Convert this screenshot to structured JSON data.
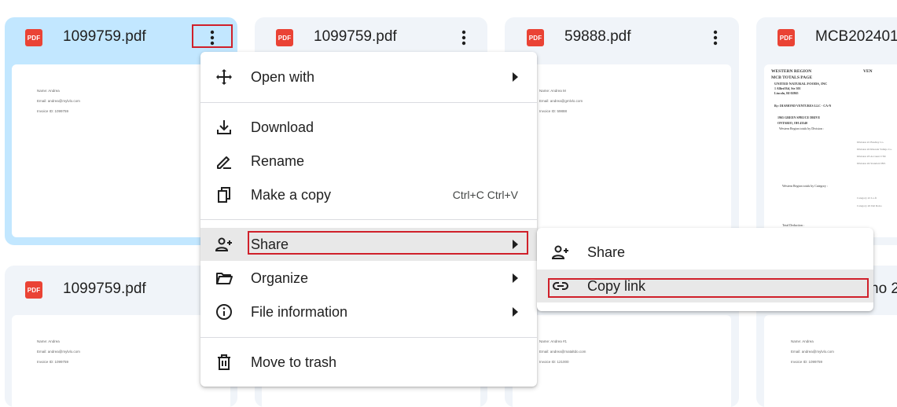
{
  "files": [
    {
      "name": "1099759.pdf",
      "badge": "PDF",
      "thumb": [
        "Name: Andrea",
        "Email: andrea@mylvlo.com",
        "Invoice ID: 1099759"
      ]
    },
    {
      "name": "1099759.pdf",
      "badge": "PDF"
    },
    {
      "name": "59888.pdf",
      "badge": "PDF",
      "thumb": [
        "Name: Andrea M",
        "Email: andrea@gmlvlo.com",
        "Invoice ID: 59888"
      ]
    },
    {
      "name": "MCB202401",
      "badge": "PDF"
    },
    {
      "name": "1099759.pdf",
      "badge": "PDF",
      "thumb": [
        "Name: Andrea",
        "Email: andrea@mylvlo.com",
        "Invoice ID: 1099759"
      ]
    },
    {
      "thumb": [
        "Name: Andrea #1",
        "Email: andrea@mataltdo.com",
        "Invoice ID: 121000"
      ]
    },
    {
      "name_partial": "no 2",
      "thumb": [
        "Name: Andrea",
        "Email: andrea@mylvlo.com",
        "Invoice ID: 1099759"
      ]
    }
  ],
  "doc_preview": {
    "lines": [
      "WESTERN REGION",
      "MCB TOTALS PAGE",
      "UNITED NATURAL FOODS, INC",
      "1 Allied Rd, Ste 301",
      "Lincoln, RI 02865",
      "By: DIAMOND VENTURES LLC - CA-N",
      "1965 GREEN SPRUCE DRIVE",
      "ONTARIO, OH 43540",
      "Western Region totals by Division :",
      "Western Region totals by Category :",
      "Total Deduction :"
    ],
    "header_right": "VEN",
    "small_rows": [
      "Division #1    Bradley Co.",
      "Division #2    Rhonda Vallejo Co.",
      "Division #3    Account CTR",
      "Division #4    Standard INS",
      "Category #1    Lo.fi",
      "Category #2    Del Roko"
    ]
  },
  "context_menu": {
    "items": [
      {
        "label": "Open with",
        "icon": "open-with-icon",
        "submenu": true
      },
      {
        "label": "Download",
        "icon": "download-icon"
      },
      {
        "label": "Rename",
        "icon": "rename-icon"
      },
      {
        "label": "Make a copy",
        "icon": "copy-icon",
        "shortcut": "Ctrl+C Ctrl+V"
      },
      {
        "label": "Share",
        "icon": "person-add-icon",
        "submenu": true
      },
      {
        "label": "Organize",
        "icon": "folder-open-icon",
        "submenu": true
      },
      {
        "label": "File information",
        "icon": "info-icon",
        "submenu": true
      },
      {
        "label": "Move to trash",
        "icon": "trash-icon"
      }
    ]
  },
  "share_submenu": {
    "items": [
      {
        "label": "Share",
        "icon": "person-add-icon"
      },
      {
        "label": "Copy link",
        "icon": "link-icon"
      }
    ]
  },
  "colors": {
    "selected_card": "#c2e7ff",
    "card": "#f0f4f9",
    "pdf_badge": "#ea4335",
    "highlight": "#d0202a"
  }
}
